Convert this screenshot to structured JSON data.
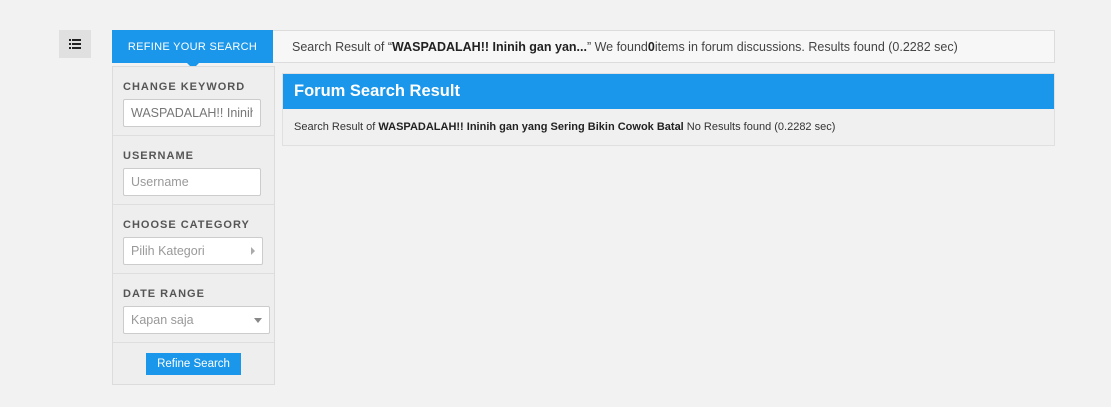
{
  "toggle": {
    "icon": "list-icon"
  },
  "topbar": {
    "refine_tab_label": "REFINE YOUR SEARCH",
    "summary_prefix": "Search Result of “",
    "summary_keyword": "WASPADALAH!! Ininih gan yan...",
    "summary_middle": "” We found ",
    "summary_count": "0",
    "summary_suffix": " items in forum discussions. Results found (0.2282 sec)"
  },
  "sidebar": {
    "keyword_label": "CHANGE KEYWORD",
    "keyword_value": "WASPADALAH!! Ininih gan yang Sering Bikin Cowok Batal",
    "username_label": "USERNAME",
    "username_placeholder": "Username",
    "category_label": "CHOOSE CATEGORY",
    "category_value": "Pilih Kategori",
    "date_label": "DATE RANGE",
    "date_value": "Kapan saja",
    "refine_button": "Refine Search"
  },
  "result": {
    "title": "Forum Search Result",
    "body_prefix": "Search Result of ",
    "body_keyword": "WASPADALAH!! Ininih gan yang Sering Bikin Cowok Batal",
    "body_suffix": " No Results found (0.2282 sec)"
  },
  "colors": {
    "accent": "#1a96ea",
    "background": "#f2f2f2"
  }
}
